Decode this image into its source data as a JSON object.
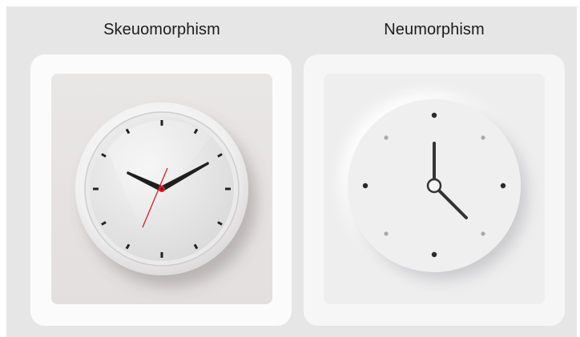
{
  "left_panel": {
    "caption": "Skeuomorphism",
    "clock_icon": "analog-clock-icon"
  },
  "right_panel": {
    "caption": "Neumorphism",
    "clock_icon": "analog-clock-icon"
  },
  "colors": {
    "background": "#e6e6e6",
    "card": "#fbfbfb",
    "skeuo_panel": "#e6e2e2",
    "neu_panel": "#eeeeef",
    "hand_dark": "#1e1e1e",
    "second_hand_red": "#d21f2a"
  }
}
